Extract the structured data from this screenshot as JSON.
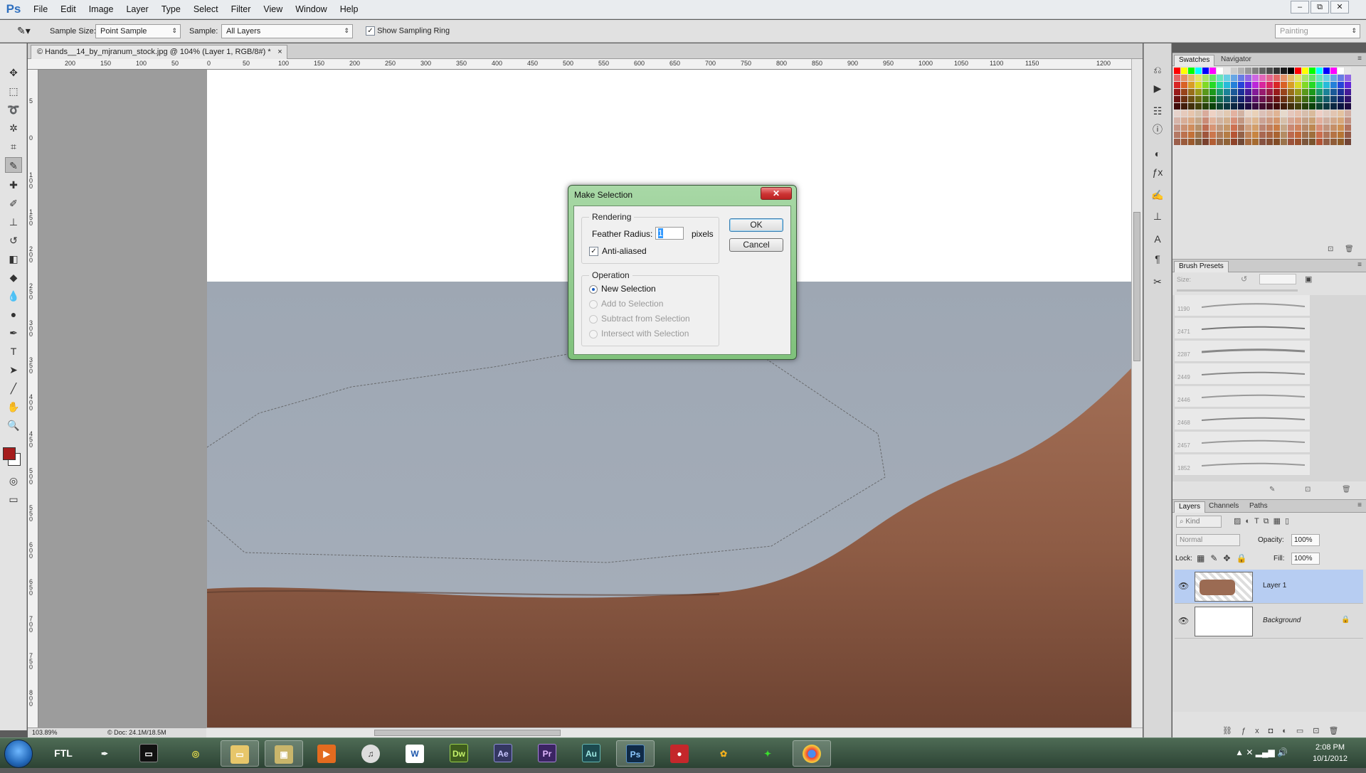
{
  "app": {
    "logo": "Ps"
  },
  "menu": [
    "File",
    "Edit",
    "Image",
    "Layer",
    "Type",
    "Select",
    "Filter",
    "View",
    "Window",
    "Help"
  ],
  "window_buttons": [
    "–",
    "⧉",
    "✕"
  ],
  "options": {
    "sample_size_label": "Sample Size:",
    "sample_size_value": "Point Sample",
    "sample_label": "Sample:",
    "sample_value": "All Layers",
    "show_ring_label": "Show Sampling Ring",
    "workspace": "Painting"
  },
  "document": {
    "tab_title": "© Hands__14_by_mjranum_stock.jpg @ 104% (Layer 1, RGB/8#) *",
    "h_ruler": [
      "200",
      "150",
      "100",
      "50",
      "0",
      "50",
      "100",
      "150",
      "200",
      "250",
      "300",
      "350",
      "400",
      "450",
      "500",
      "550",
      "600",
      "650",
      "700",
      "750",
      "800",
      "850",
      "900",
      "950",
      "1000",
      "1050",
      "1100",
      "1150",
      "1200"
    ],
    "v_ruler": [
      "5",
      "0",
      "1 0 0",
      "1 5 0",
      "2 0 0",
      "2 5 0",
      "3 0 0",
      "3 5 0",
      "4 0 0",
      "4 5 0",
      "5 0 0",
      "5 5 0",
      "6 0 0",
      "6 5 0",
      "7 0 0",
      "7 5 0",
      "8 0 0"
    ],
    "zoom": "103.89%",
    "doc_size": "© Doc: 24.1M/18.5M"
  },
  "dialog": {
    "title": "Make Selection",
    "close": "✕",
    "rendering_label": "Rendering",
    "feather_label": "Feather Radius:",
    "feather_value": "1",
    "feather_unit": "pixels",
    "anti_aliased_label": "Anti-aliased",
    "anti_aliased_checked": true,
    "operation_label": "Operation",
    "operations": [
      "New Selection",
      "Add to Selection",
      "Subtract from Selection",
      "Intersect with Selection"
    ],
    "selected_operation": 0,
    "ok_label": "OK",
    "cancel_label": "Cancel"
  },
  "panels": {
    "swatches_tab": "Swatches",
    "navigator_tab": "Navigator",
    "brush_presets_tab": "Brush Presets",
    "brush_size_label": "Size:",
    "brush_sizes": [
      "1190",
      "2471",
      "2287",
      "2449",
      "2446",
      "2468",
      "2457",
      "1852"
    ],
    "layers_tab": "Layers",
    "channels_tab": "Channels",
    "paths_tab": "Paths",
    "kind_label": "Kind",
    "blend_mode": "Normal",
    "opacity_label": "Opacity:",
    "opacity_value": "100%",
    "lock_label": "Lock:",
    "fill_label": "Fill:",
    "fill_value": "100%",
    "layers": [
      {
        "name": "Layer 1",
        "selected": true
      },
      {
        "name": "Background",
        "selected": false
      }
    ]
  },
  "taskbar": {
    "apps": [
      "FTL",
      "",
      "",
      "",
      "",
      "",
      "",
      "",
      "W",
      "Dw",
      "Ae",
      "Pr",
      "Au",
      "Ps",
      "",
      "",
      "",
      ""
    ],
    "time": "2:08 PM",
    "date": "10/1/2012"
  },
  "colors": {
    "foreground": "#a51d1d",
    "background": "#ffffff",
    "dialog_frame": "#86c482",
    "selected_layer": "#b7cdf2"
  }
}
